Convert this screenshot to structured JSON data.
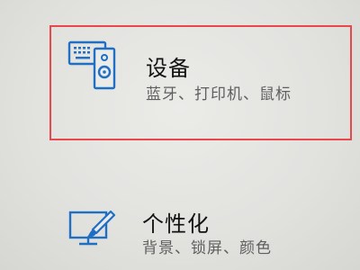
{
  "settings_tiles": [
    {
      "title": "设备",
      "subtitle": "蓝牙、打印机、鼠标",
      "icon": "keyboard-speaker-icon",
      "highlighted": true
    },
    {
      "title": "个性化",
      "subtitle": "背景、锁屏、颜色",
      "icon": "monitor-brush-icon",
      "highlighted": false
    }
  ],
  "colors": {
    "icon_blue": "#1f6fc5",
    "highlight_red": "#e8474c",
    "title_text": "#111111",
    "subtitle_text": "#5f5f5f"
  }
}
